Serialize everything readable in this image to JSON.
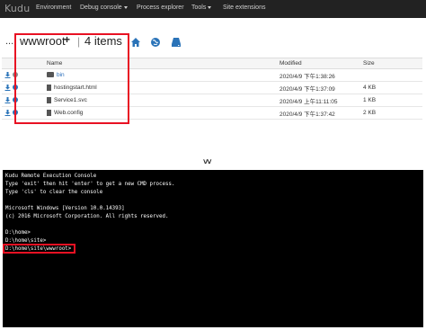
{
  "navbar": {
    "brand": "Kudu",
    "items": [
      {
        "label": "Environment",
        "caret": false
      },
      {
        "label": "Debug console",
        "caret": true
      },
      {
        "label": "Process explorer",
        "caret": false
      },
      {
        "label": "Tools",
        "caret": true
      },
      {
        "label": "Site extensions",
        "caret": false
      }
    ]
  },
  "breadcrumb": {
    "ellipsis": "...",
    "folder": "wwwroot",
    "plus": "+",
    "separator": "|",
    "items_count": "4 items"
  },
  "icons": {
    "home": "home-icon",
    "globe": "globe-icon",
    "drive": "drive-icon",
    "download": "download-icon",
    "circle": "circle-icon",
    "folder": "folder-icon",
    "file": "file-icon",
    "chevron": "chevron-down-icon"
  },
  "file_table": {
    "headers": {
      "name": "Name",
      "modified": "Modified",
      "size": "Size"
    },
    "rows": [
      {
        "name": "bin",
        "type": "folder",
        "modified": "2020/4/9 下午1:38:26",
        "size": ""
      },
      {
        "name": "hostingstart.html",
        "type": "file",
        "modified": "2020/4/9 下午1:37:09",
        "size": "4 KB"
      },
      {
        "name": "Service1.svc",
        "type": "file",
        "modified": "2020/4/9 上午11:11:05",
        "size": "1 KB"
      },
      {
        "name": "Web.config",
        "type": "file",
        "modified": "2020/4/9 下午1:37:42",
        "size": "2 KB"
      }
    ]
  },
  "chevrons": "˅˅",
  "console": {
    "lines": [
      "Kudu Remote Execution Console",
      "Type 'exit' then hit 'enter' to get a new CMD process.",
      "Type 'cls' to clear the console",
      "",
      "Microsoft Windows [Version 10.0.14393]",
      "(c) 2016 Microsoft Corporation. All rights reserved.",
      "",
      "D:\\home>",
      "D:\\home\\site>",
      "D:\\home\\site\\wwwroot>"
    ]
  },
  "colors": {
    "navbar_bg": "#222222",
    "highlight_red": "#e81123",
    "link_blue": "#2a6ebb",
    "icon_blue": "#2a73b8",
    "console_bg": "#000000"
  }
}
